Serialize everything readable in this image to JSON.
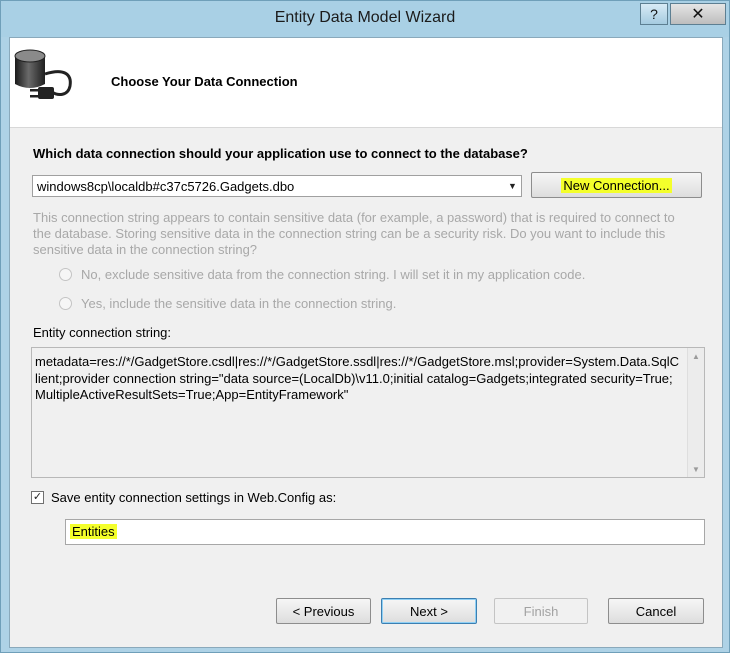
{
  "window": {
    "title": "Entity Data Model Wizard",
    "help_label": "?",
    "close_label": "✕"
  },
  "header": {
    "title": "Choose Your Data Connection",
    "icon": "database-plug-icon"
  },
  "connection": {
    "question": "Which data connection should your application use to connect to the database?",
    "selected": "windows8cp\\localdb#c37c5726.Gadgets.dbo",
    "new_connection_label": "New Connection..."
  },
  "sensitive": {
    "text": "This connection string appears to contain sensitive data (for example, a password) that is required to connect to the database. Storing sensitive data in the connection string can be a security risk. Do you want to include this sensitive data in the connection string?",
    "option_no": "No, exclude sensitive data from the connection string. I will set it in my application code.",
    "option_yes": "Yes, include the sensitive data in the connection string."
  },
  "entity_connection": {
    "label": "Entity connection string:",
    "value": "metadata=res://*/GadgetStore.csdl|res://*/GadgetStore.ssdl|res://*/GadgetStore.msl;provider=System.Data.SqlClient;provider connection string=\"data source=(LocalDb)\\v11.0;initial catalog=Gadgets;integrated security=True;MultipleActiveResultSets=True;App=EntityFramework\""
  },
  "save_settings": {
    "label": "Save entity connection settings in Web.Config as:",
    "checked": true,
    "name_value": "Entities"
  },
  "buttons": {
    "previous": "< Previous",
    "next": "Next >",
    "finish": "Finish",
    "cancel": "Cancel"
  },
  "colors": {
    "highlight": "#f4ff2b",
    "disabled_text": "#a8a8a8",
    "title_bar": "#a9d0e5"
  }
}
